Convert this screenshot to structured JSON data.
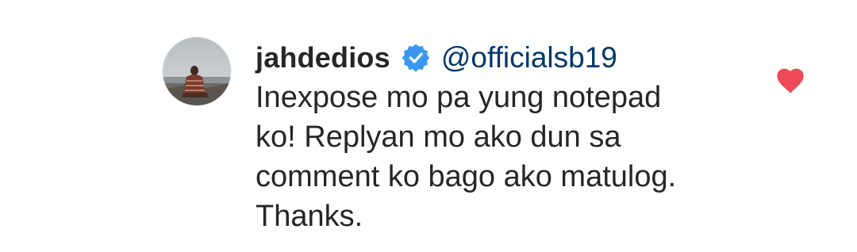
{
  "comment": {
    "username": "jahdedios",
    "verified": true,
    "mention": "@officialsb19",
    "text_lines": [
      "Inexpose mo pa yung notepad",
      "ko! Replyan mo ako dun sa",
      "comment ko bago ako matulog.",
      "Thanks."
    ],
    "liked": true
  },
  "icons": {
    "verified": "verified-badge-icon",
    "like": "heart-icon"
  },
  "colors": {
    "username": "#262626",
    "mention": "#00376b",
    "verified_badge": "#3897f0",
    "heart": "#ed4956",
    "background": "#ffffff"
  }
}
